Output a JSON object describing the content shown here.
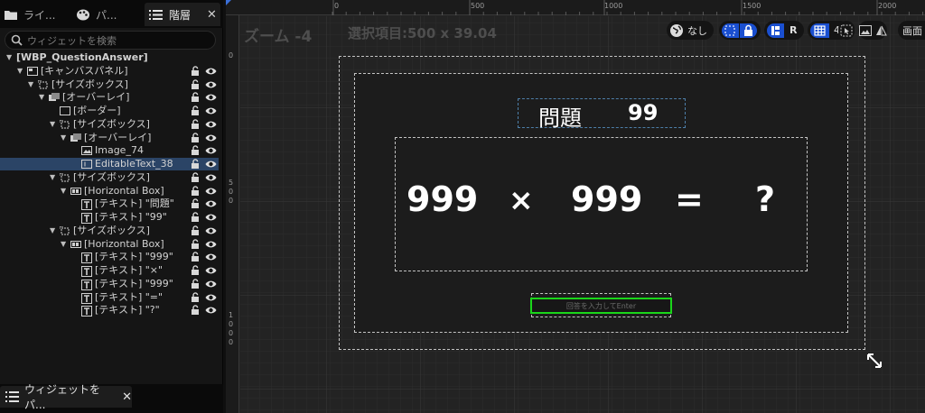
{
  "top_tabs": [
    {
      "label": "ライ..."
    },
    {
      "label": "パ..."
    },
    {
      "label": "階層"
    }
  ],
  "search": {
    "placeholder": "ウィジェットを検索"
  },
  "tree": [
    {
      "label": "[WBP_QuestionAnswer]",
      "depth": 0,
      "expanded": true,
      "icon": "none",
      "bold": true
    },
    {
      "label": "[キャンバスパネル]",
      "depth": 1,
      "expanded": true,
      "icon": "canvas-panel"
    },
    {
      "label": "[サイズボックス]",
      "depth": 2,
      "expanded": true,
      "icon": "size-box"
    },
    {
      "label": "[オーバーレイ]",
      "depth": 3,
      "expanded": true,
      "icon": "overlay"
    },
    {
      "label": "[ボーダー]",
      "depth": 4,
      "expanded": null,
      "icon": "border"
    },
    {
      "label": "[サイズボックス]",
      "depth": 4,
      "expanded": true,
      "icon": "size-box"
    },
    {
      "label": "[オーバーレイ]",
      "depth": 5,
      "expanded": true,
      "icon": "overlay"
    },
    {
      "label": "Image_74",
      "depth": 6,
      "expanded": null,
      "icon": "image"
    },
    {
      "label": "EditableText_38",
      "depth": 6,
      "expanded": null,
      "icon": "editable-text",
      "selected": true
    },
    {
      "label": "[サイズボックス]",
      "depth": 4,
      "expanded": true,
      "icon": "size-box"
    },
    {
      "label": "[Horizontal Box]",
      "depth": 5,
      "expanded": true,
      "icon": "horizontal-box"
    },
    {
      "label": "[テキスト] \"問題\"",
      "depth": 6,
      "expanded": null,
      "icon": "text"
    },
    {
      "label": "[テキスト] \"99\"",
      "depth": 6,
      "expanded": null,
      "icon": "text"
    },
    {
      "label": "[サイズボックス]",
      "depth": 4,
      "expanded": true,
      "icon": "size-box"
    },
    {
      "label": "[Horizontal Box]",
      "depth": 5,
      "expanded": true,
      "icon": "horizontal-box"
    },
    {
      "label": "[テキスト] \"999\"",
      "depth": 6,
      "expanded": null,
      "icon": "text"
    },
    {
      "label": "[テキスト] \"×\"",
      "depth": 6,
      "expanded": null,
      "icon": "text"
    },
    {
      "label": "[テキスト] \"999\"",
      "depth": 6,
      "expanded": null,
      "icon": "text"
    },
    {
      "label": "[テキスト] \"=\"",
      "depth": 6,
      "expanded": null,
      "icon": "text"
    },
    {
      "label": "[テキスト] \"?\"",
      "depth": 6,
      "expanded": null,
      "icon": "text"
    }
  ],
  "bottom_tab": {
    "label": "ウィジェットをパ..."
  },
  "ruler": {
    "top": [
      "0",
      "500",
      "1000",
      "1500",
      "2000"
    ],
    "left_labels": [
      [
        "0"
      ],
      [
        "5",
        "0",
        "0"
      ],
      [
        "1",
        "0",
        "0",
        "0"
      ]
    ]
  },
  "designer": {
    "zoom_label": "ズーム -4",
    "selection_label": "選択項目:500 x 39.04"
  },
  "toolbar": {
    "localization_label": "なし",
    "respect_locks_key": "R",
    "grid_snap_value": "4",
    "screen_size_label": "画面"
  },
  "canvas": {
    "question_label": "問題",
    "question_number": "99",
    "operand_a": "999",
    "operator": "×",
    "operand_b": "999",
    "equals": "=",
    "answer": "?",
    "input_hint": "回答を入力してEnter"
  },
  "colors": {
    "selection_highlight": "#2b4466",
    "input_focus_border": "#1ad61a",
    "accent_blue": "#1a4fd0"
  }
}
